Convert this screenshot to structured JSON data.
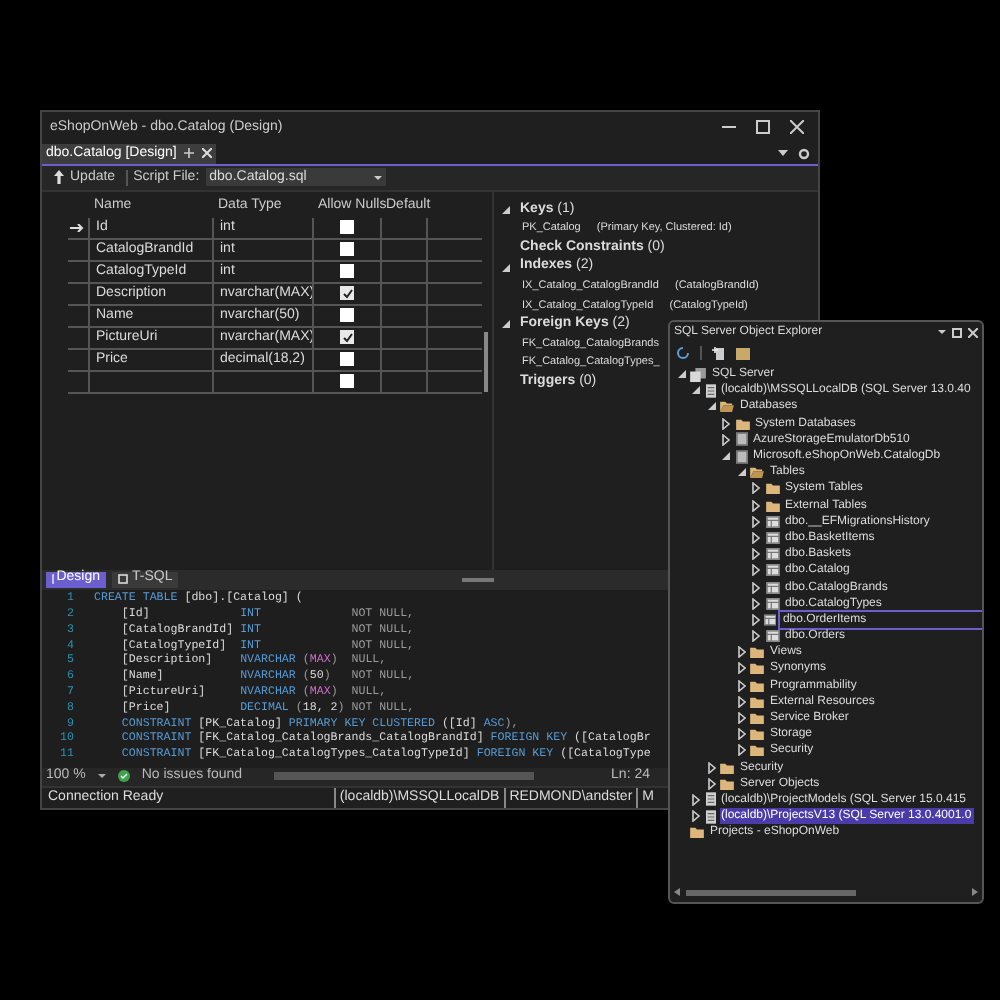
{
  "window": {
    "title": "eShopOnWeb - dbo.Catalog (Design)"
  },
  "document_tab": {
    "label": "dbo.Catalog [Design]",
    "selected": true
  },
  "toolbar": {
    "update": "Update",
    "script_file_label": "Script File:",
    "script_file": "dbo.Catalog.sql"
  },
  "grid": {
    "columns": [
      "Name",
      "Data Type",
      "Allow Nulls",
      "Default"
    ],
    "rows": [
      {
        "name": "Id",
        "type": "int",
        "allow_nulls": false,
        "primary_key": true
      },
      {
        "name": "CatalogBrandId",
        "type": "int",
        "allow_nulls": false,
        "primary_key": false
      },
      {
        "name": "CatalogTypeId",
        "type": "int",
        "allow_nulls": false,
        "primary_key": false
      },
      {
        "name": "Description",
        "type": "nvarchar(MAX)",
        "allow_nulls": true,
        "primary_key": false
      },
      {
        "name": "Name",
        "type": "nvarchar(50)",
        "allow_nulls": false,
        "primary_key": false
      },
      {
        "name": "PictureUri",
        "type": "nvarchar(MAX)",
        "allow_nulls": true,
        "primary_key": false
      },
      {
        "name": "Price",
        "type": "decimal(18,2)",
        "allow_nulls": false,
        "primary_key": false
      },
      {
        "allow_nulls": false,
        "primary_key": false
      }
    ]
  },
  "properties": [
    {
      "label": "**Keys** (1)",
      "expanded": true,
      "children": [
        {
          "name": "PK_Catalog",
          "detail": "(Primary Key, Clustered: Id)"
        }
      ]
    },
    {
      "label": "**Check Constraints** (0)"
    },
    {
      "label": "**Indexes** (2)",
      "expanded": true,
      "children": [
        {
          "name": "IX_Catalog_CatalogBrandId",
          "detail": "(CatalogBrandId)"
        },
        {
          "name": "IX_Catalog_CatalogTypeId",
          "detail": "(CatalogTypeId)"
        }
      ]
    },
    {
      "label": "**Foreign Keys** (2)",
      "expanded": true,
      "children": [
        {
          "name": "FK_Catalog_CatalogBrands"
        },
        {
          "name": "FK_Catalog_CatalogTypes_"
        }
      ]
    },
    {
      "label": "**Triggers** (0)"
    }
  ],
  "view_tabs": [
    {
      "label": "Design",
      "selected": true
    },
    {
      "label": "T-SQL",
      "selected": false
    }
  ],
  "code": [
    {
      "number": "1",
      "tokens": [
        {
          "kind": "keyword",
          "text": "CREATE TABLE"
        },
        {
          "kind": "name",
          "text": " [dbo].[Catalog] ("
        }
      ]
    },
    {
      "number": "2",
      "tokens": [
        {
          "kind": "name",
          "text": "    [Id]             "
        },
        {
          "kind": "keyword",
          "text": "INT"
        },
        {
          "kind": "operator",
          "text": "             NOT NULL,"
        }
      ]
    },
    {
      "number": "3",
      "tokens": [
        {
          "kind": "name",
          "text": "    [CatalogBrandId] "
        },
        {
          "kind": "keyword",
          "text": "INT"
        },
        {
          "kind": "operator",
          "text": "             NOT NULL,"
        }
      ]
    },
    {
      "number": "4",
      "tokens": [
        {
          "kind": "name",
          "text": "    [CatalogTypeId]  "
        },
        {
          "kind": "keyword",
          "text": "INT"
        },
        {
          "kind": "operator",
          "text": "             NOT NULL,"
        }
      ]
    },
    {
      "number": "5",
      "tokens": [
        {
          "kind": "name",
          "text": "    [Description]    "
        },
        {
          "kind": "keyword",
          "text": "NVARCHAR"
        },
        {
          "kind": "operator",
          "text": " ("
        },
        {
          "kind": "function",
          "text": "MAX"
        },
        {
          "kind": "operator",
          "text": ")  NULL,"
        }
      ]
    },
    {
      "number": "6",
      "tokens": [
        {
          "kind": "name",
          "text": "    [Name]           "
        },
        {
          "kind": "keyword",
          "text": "NVARCHAR"
        },
        {
          "kind": "operator",
          "text": " ("
        },
        {
          "kind": "name",
          "text": "50"
        },
        {
          "kind": "operator",
          "text": ")   NOT NULL,"
        }
      ]
    },
    {
      "number": "7",
      "tokens": [
        {
          "kind": "name",
          "text": "    [PictureUri]     "
        },
        {
          "kind": "keyword",
          "text": "NVARCHAR"
        },
        {
          "kind": "operator",
          "text": " ("
        },
        {
          "kind": "function",
          "text": "MAX"
        },
        {
          "kind": "operator",
          "text": ")  NULL,"
        }
      ]
    },
    {
      "number": "8",
      "tokens": [
        {
          "kind": "name",
          "text": "    [Price]          "
        },
        {
          "kind": "keyword",
          "text": "DECIMAL"
        },
        {
          "kind": "operator",
          "text": " ("
        },
        {
          "kind": "name",
          "text": "18, 2"
        },
        {
          "kind": "operator",
          "text": ") NOT NULL,"
        }
      ]
    },
    {
      "number": "9",
      "tokens": [
        {
          "kind": "keyword",
          "text": "    CONSTRAINT"
        },
        {
          "kind": "name",
          "text": " [PK_Catalog] "
        },
        {
          "kind": "keyword",
          "text": "PRIMARY KEY CLUSTERED"
        },
        {
          "kind": "name",
          "text": " ([Id] "
        },
        {
          "kind": "keyword",
          "text": "ASC"
        },
        {
          "kind": "operator",
          "text": "),"
        }
      ]
    },
    {
      "number": "10",
      "tokens": [
        {
          "kind": "keyword",
          "text": "    CONSTRAINT"
        },
        {
          "kind": "name",
          "text": " [FK_Catalog_CatalogBrands_CatalogBrandId] "
        },
        {
          "kind": "keyword",
          "text": "FOREIGN KEY"
        },
        {
          "kind": "name",
          "text": " ([CatalogBr"
        }
      ]
    },
    {
      "number": "11",
      "tokens": [
        {
          "kind": "keyword",
          "text": "    CONSTRAINT"
        },
        {
          "kind": "name",
          "text": " [FK_Catalog_CatalogTypes_CatalogTypeId] "
        },
        {
          "kind": "keyword",
          "text": "FOREIGN KEY"
        },
        {
          "kind": "name",
          "text": " ([CatalogType"
        }
      ]
    }
  ],
  "editor_status": {
    "zoom": "100 %",
    "issues": "No issues found",
    "position": "Ln: 24"
  },
  "status_bar": {
    "message": "Connection Ready",
    "items": [
      "(localdb)\\MSSQLLocalDB",
      "REDMOND\\andster",
      "M"
    ]
  },
  "explorer": {
    "title": "SQL Server Object Explorer",
    "tree": [
      {
        "label": "SQL Server",
        "kind": "servers",
        "expanded": true,
        "selected": false,
        "children": [
          {
            "label": "(localdb)\\MSSQLLocalDB (SQL Server 13.0.40",
            "kind": "server",
            "expanded": true,
            "selected": false,
            "children": [
              {
                "label": "Databases",
                "kind": "openfolder",
                "expanded": true,
                "selected": false,
                "children": [
                  {
                    "label": "System Databases",
                    "kind": "folder",
                    "expanded": false,
                    "selected": false
                  },
                  {
                    "label": "AzureStorageEmulatorDb510",
                    "kind": "database",
                    "expanded": false,
                    "selected": false
                  },
                  {
                    "label": "Microsoft.eShopOnWeb.CatalogDb",
                    "kind": "database",
                    "expanded": true,
                    "selected": false,
                    "children": [
                      {
                        "label": "Tables",
                        "kind": "openfolder",
                        "expanded": true,
                        "selected": false,
                        "children": [
                          {
                            "label": "System Tables",
                            "kind": "folder",
                            "expanded": false,
                            "selected": false
                          },
                          {
                            "label": "External Tables",
                            "kind": "folder",
                            "expanded": false,
                            "selected": false
                          },
                          {
                            "label": "dbo.__EFMigrationsHistory",
                            "kind": "table",
                            "expanded": false,
                            "selected": false
                          },
                          {
                            "label": "dbo.BasketItems",
                            "kind": "table",
                            "expanded": false,
                            "selected": false
                          },
                          {
                            "label": "dbo.Baskets",
                            "kind": "table",
                            "expanded": false,
                            "selected": false
                          },
                          {
                            "label": "dbo.Catalog",
                            "kind": "table",
                            "expanded": false,
                            "selected": false
                          },
                          {
                            "label": "dbo.CatalogBrands",
                            "kind": "table",
                            "expanded": false,
                            "selected": false
                          },
                          {
                            "label": "dbo.CatalogTypes",
                            "kind": "table",
                            "expanded": false,
                            "selected": false
                          },
                          {
                            "label": "dbo.OrderItems",
                            "kind": "table",
                            "expanded": false,
                            "selected": false,
                            "focused": true
                          },
                          {
                            "label": "dbo.Orders",
                            "kind": "table",
                            "expanded": false,
                            "selected": false
                          }
                        ]
                      },
                      {
                        "label": "Views",
                        "kind": "folder",
                        "expanded": false,
                        "selected": false
                      },
                      {
                        "label": "Synonyms",
                        "kind": "folder",
                        "expanded": false,
                        "selected": false
                      },
                      {
                        "label": "Programmability",
                        "kind": "folder",
                        "expanded": false,
                        "selected": false
                      },
                      {
                        "label": "External Resources",
                        "kind": "folder",
                        "expanded": false,
                        "selected": false
                      },
                      {
                        "label": "Service Broker",
                        "kind": "folder",
                        "expanded": false,
                        "selected": false
                      },
                      {
                        "label": "Storage",
                        "kind": "folder",
                        "expanded": false,
                        "selected": false
                      },
                      {
                        "label": "Security",
                        "kind": "folder",
                        "expanded": false,
                        "selected": false
                      }
                    ]
                  }
                ]
              },
              {
                "label": "Security",
                "kind": "folder",
                "expanded": false,
                "selected": false
              },
              {
                "label": "Server Objects",
                "kind": "folder",
                "expanded": false,
                "selected": false
              }
            ]
          },
          {
            "label": "(localdb)\\ProjectModels (SQL Server 15.0.415",
            "kind": "server",
            "expanded": false,
            "selected": false
          },
          {
            "label": "(localdb)\\ProjectsV13 (SQL Server 13.0.4001.0",
            "kind": "server",
            "expanded": false,
            "selected": true
          }
        ]
      },
      {
        "label": "Projects - eShopOnWeb",
        "kind": "folder",
        "selected": false
      }
    ]
  }
}
